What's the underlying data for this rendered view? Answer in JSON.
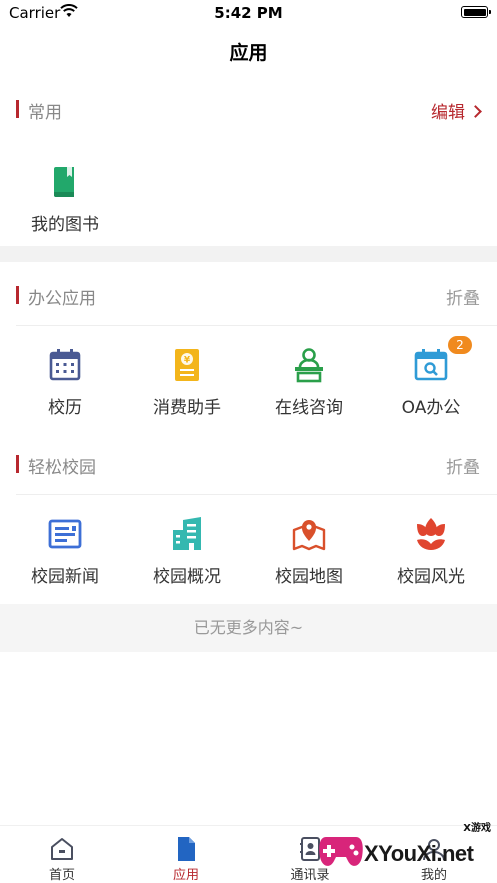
{
  "status_bar": {
    "carrier": "Carrier",
    "time": "5:42 PM"
  },
  "nav": {
    "title": "应用"
  },
  "sections": {
    "common": {
      "title": "常用",
      "action": "编辑",
      "items": [
        {
          "label": "我的图书",
          "icon": "book-icon",
          "color": "#22a86b"
        }
      ]
    },
    "office": {
      "title": "办公应用",
      "action": "折叠",
      "items": [
        {
          "label": "校历",
          "icon": "calendar-icon",
          "color": "#4a5a93"
        },
        {
          "label": "消费助手",
          "icon": "yuan-document-icon",
          "color": "#f3b51b"
        },
        {
          "label": "在线咨询",
          "icon": "consult-person-icon",
          "color": "#2a9f4a"
        },
        {
          "label": "OA办公",
          "icon": "calendar-search-icon",
          "color": "#2f9bd6",
          "badge": "2"
        }
      ]
    },
    "campus": {
      "title": "轻松校园",
      "action": "折叠",
      "items": [
        {
          "label": "校园新闻",
          "icon": "news-icon",
          "color": "#3d6fd6"
        },
        {
          "label": "校园概况",
          "icon": "building-icon",
          "color": "#34b8b0"
        },
        {
          "label": "校园地图",
          "icon": "map-pin-icon",
          "color": "#d9502b"
        },
        {
          "label": "校园风光",
          "icon": "flower-icon",
          "color": "#e0452f"
        }
      ]
    }
  },
  "footer_note": "已无更多内容~",
  "tabs": [
    {
      "label": "首页",
      "icon": "home-icon"
    },
    {
      "label": "应用",
      "icon": "document-icon",
      "active": true
    },
    {
      "label": "通讯录",
      "icon": "contacts-icon"
    },
    {
      "label": "我的",
      "icon": "profile-icon"
    }
  ],
  "colors": {
    "accent": "#b7282e",
    "badge": "#f08a1e"
  },
  "watermark": {
    "text": "XYouXi.net",
    "small": "X游戏"
  }
}
